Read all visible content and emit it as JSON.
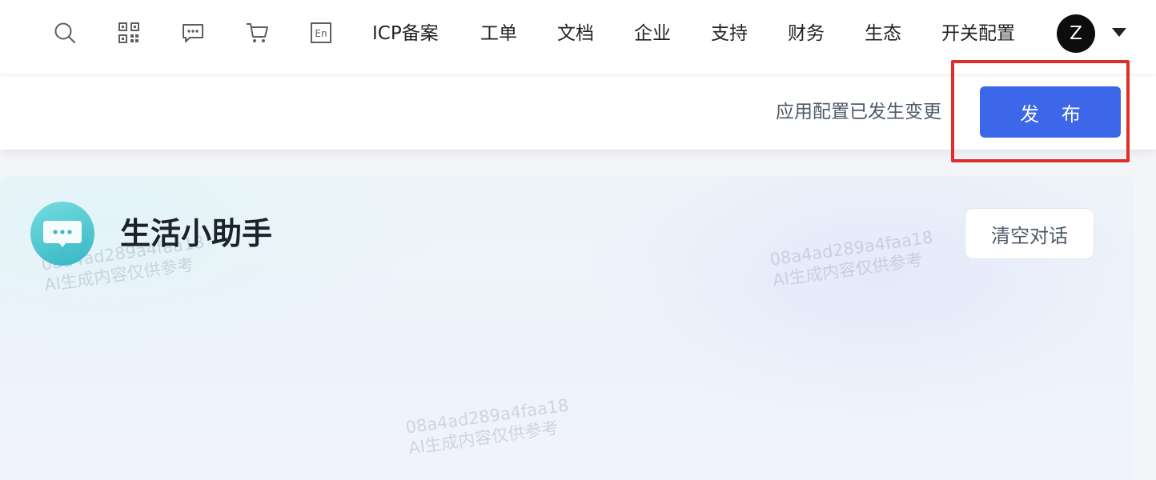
{
  "nav": {
    "icons": [
      {
        "name": "search-icon"
      },
      {
        "name": "qr-code-icon"
      },
      {
        "name": "message-icon"
      },
      {
        "name": "cart-icon"
      },
      {
        "name": "language-en-icon"
      }
    ],
    "language_label": "En",
    "links": [
      "ICP备案",
      "工单",
      "文档",
      "企业",
      "支持",
      "财务",
      "生态",
      "开关配置"
    ],
    "avatar_letter": "Z"
  },
  "publish_bar": {
    "notice": "应用配置已发生变更",
    "publish_label": "发 布"
  },
  "chat": {
    "title": "生活小助手",
    "clear_label": "清空对话",
    "watermark_lines": [
      "08a4ad289a4faa18",
      "AI生成内容仅供参考"
    ]
  },
  "colors": {
    "primary": "#3b67e8",
    "highlight": "#e02f2a",
    "avatar_bg": "#0d0d0d",
    "bot_avatar": "#4cc6d0"
  }
}
